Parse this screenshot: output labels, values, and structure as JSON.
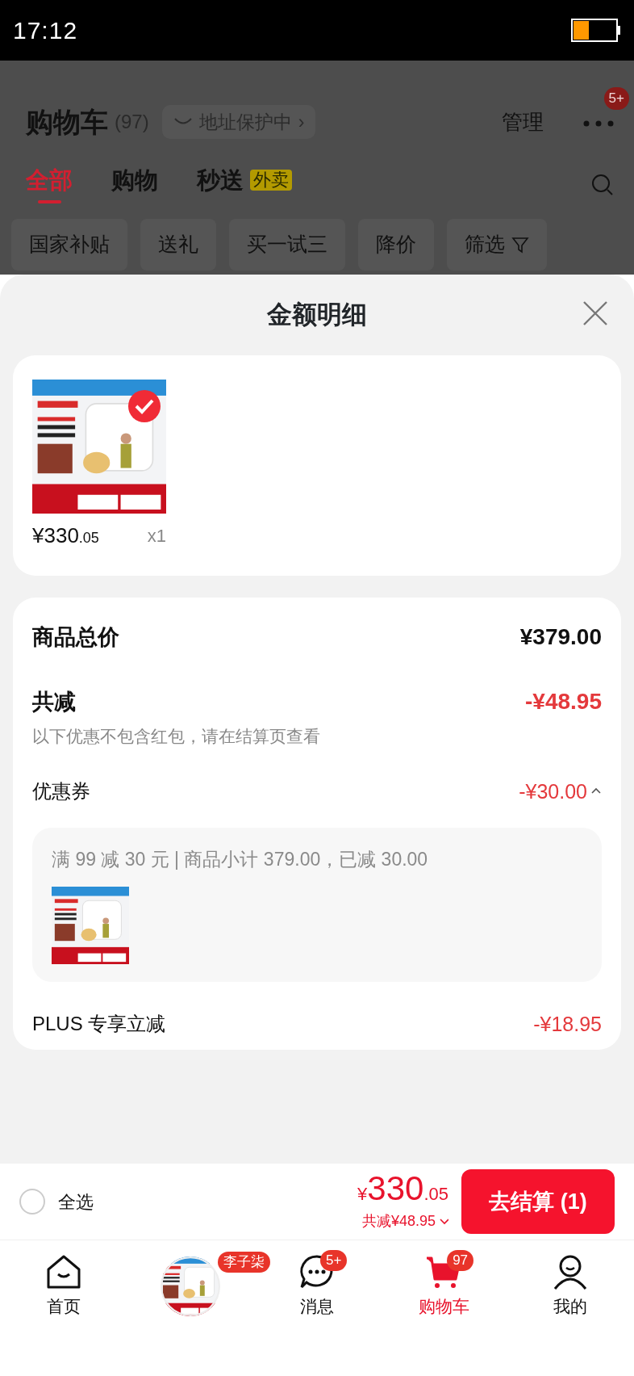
{
  "status_bar": {
    "time": "17:12"
  },
  "header": {
    "title": "购物车",
    "count": "(97)",
    "address_chip": "地址保护中",
    "chevron": "›",
    "manage": "管理",
    "more_badge": "5+"
  },
  "tabs": [
    {
      "label": "全部",
      "selected": true
    },
    {
      "label": "购物",
      "selected": false
    },
    {
      "label": "秒送",
      "tag": "外卖",
      "selected": false
    }
  ],
  "filters": [
    "国家补贴",
    "送礼",
    "买一试三",
    "降价",
    "筛选"
  ],
  "sheet": {
    "title": "金额明细",
    "items": [
      {
        "kind": "picture",
        "selected": true,
        "price_int": "¥330",
        "price_dec": ".05",
        "qty": "x1"
      }
    ],
    "total_label": "商品总价",
    "total": "¥379.00",
    "discount_label": "共减",
    "discount": "-¥48.95",
    "note": "以下优惠不包含红包，请在结算页查看",
    "coupon": {
      "label": "优惠券",
      "amount": "-¥30.00",
      "expanded": true,
      "detail": "满 99 减 30 元 | 商品小计 379.00，已减 30.00"
    },
    "plus_label": "PLUS 专享立减",
    "plus_amount": "-¥18.95"
  },
  "footer": {
    "select_all": {
      "label": "全选",
      "checked": false
    },
    "currency": "¥",
    "amount_int": "330",
    "amount_dec": ".05",
    "saved": "共减¥48.95",
    "checkout": "去结算 (1)"
  },
  "nav": [
    {
      "kind": "home",
      "label": "首页",
      "selected": false
    },
    {
      "kind": "picture",
      "badge": "李子柒",
      "selected": false
    },
    {
      "kind": "message",
      "label": "消息",
      "badge": "5+",
      "selected": false
    },
    {
      "kind": "cart",
      "label": "购物车",
      "badge": "97",
      "selected": true
    },
    {
      "kind": "profile",
      "label": "我的",
      "selected": false
    }
  ]
}
